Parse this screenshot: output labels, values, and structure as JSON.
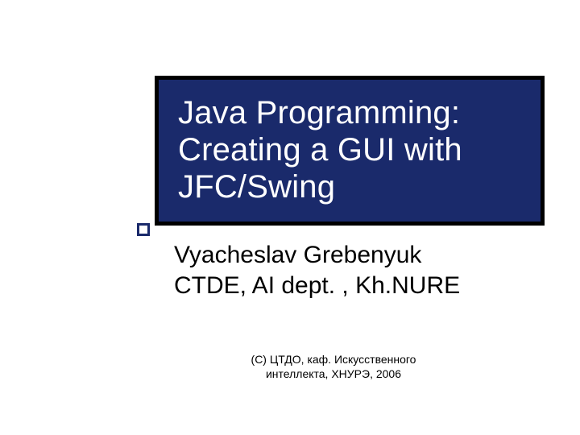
{
  "title": {
    "line1": "Java Programming:",
    "line2": "Creating a GUI with JFC/Swing"
  },
  "author": {
    "name": "Vyacheslav Grebenyuk",
    "affiliation": "CTDE, AI dept. , Kh.NURE"
  },
  "footer": {
    "line1": "(С) ЦТДО, каф. Искусственного",
    "line2": "интеллекта, ХНУРЭ, 2006"
  },
  "colors": {
    "title_bg": "#1a2a6b",
    "title_border": "#000000",
    "title_text": "#ffffff",
    "accent_border": "#1a2a6b"
  }
}
